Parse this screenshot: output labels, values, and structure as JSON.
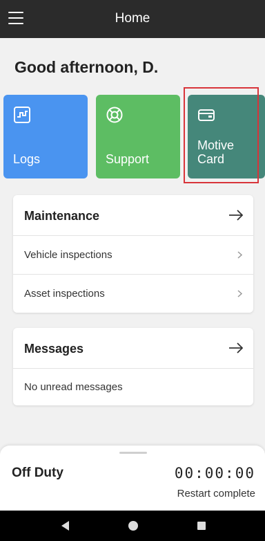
{
  "header": {
    "title": "Home",
    "menu_icon": "hamburger-menu-icon"
  },
  "greeting": "Good afternoon, D.",
  "tiles": [
    {
      "label": "Logs",
      "icon": "logs-chart-icon",
      "color": "#4a94f0"
    },
    {
      "label": "Support",
      "icon": "lifebuoy-icon",
      "color": "#5dbd63"
    },
    {
      "label": "Motive\nCard",
      "icon": "credit-card-icon",
      "color": "#45877a"
    }
  ],
  "maintenance": {
    "title": "Maintenance",
    "items": [
      {
        "label": "Vehicle inspections"
      },
      {
        "label": "Asset inspections"
      }
    ]
  },
  "messages": {
    "title": "Messages",
    "empty_text": "No unread messages"
  },
  "status": {
    "duty": "Off Duty",
    "timer": "00:00:00",
    "restart": "Restart complete"
  },
  "colors": {
    "highlight": "#d8343a",
    "topbar": "#2b2b2b"
  }
}
